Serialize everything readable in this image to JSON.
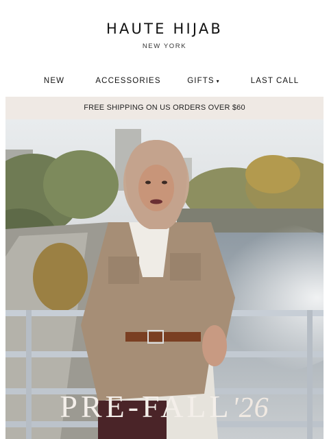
{
  "brand": {
    "name": "HAUTE HIJAB",
    "location": "NEW YORK"
  },
  "nav": {
    "items": [
      {
        "label": "NEW"
      },
      {
        "label": "ACCESSORIES"
      },
      {
        "label": "GIFTS",
        "icon": "chevron-down-icon"
      },
      {
        "label": "LAST CALL"
      }
    ]
  },
  "banner": {
    "text": "FREE SHIPPING ON US ORDERS OVER $60"
  },
  "hero": {
    "title": "PRE-FALL",
    "year": "'26"
  },
  "colors": {
    "banner_bg": "#efe9e4",
    "text": "#111111",
    "title": "#f4efea"
  }
}
